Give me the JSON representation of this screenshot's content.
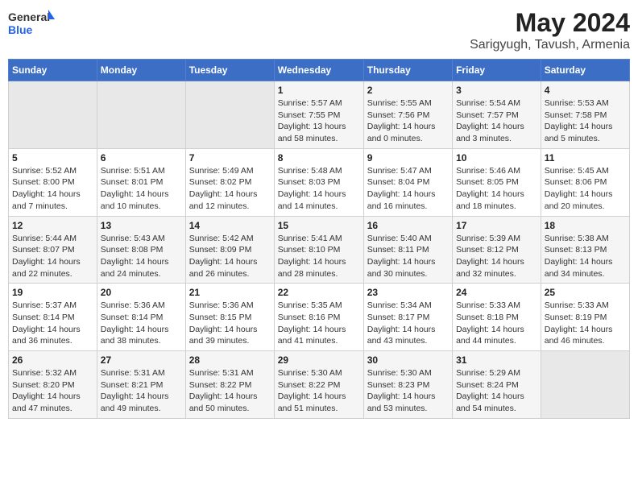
{
  "header": {
    "logo_text_general": "General",
    "logo_text_blue": "Blue",
    "month_year": "May 2024",
    "location": "Sarigyugh, Tavush, Armenia"
  },
  "calendar": {
    "days_of_week": [
      "Sunday",
      "Monday",
      "Tuesday",
      "Wednesday",
      "Thursday",
      "Friday",
      "Saturday"
    ],
    "weeks": [
      [
        {
          "day": "",
          "info": ""
        },
        {
          "day": "",
          "info": ""
        },
        {
          "day": "",
          "info": ""
        },
        {
          "day": "1",
          "info": "Sunrise: 5:57 AM\nSunset: 7:55 PM\nDaylight: 13 hours and 58 minutes."
        },
        {
          "day": "2",
          "info": "Sunrise: 5:55 AM\nSunset: 7:56 PM\nDaylight: 14 hours and 0 minutes."
        },
        {
          "day": "3",
          "info": "Sunrise: 5:54 AM\nSunset: 7:57 PM\nDaylight: 14 hours and 3 minutes."
        },
        {
          "day": "4",
          "info": "Sunrise: 5:53 AM\nSunset: 7:58 PM\nDaylight: 14 hours and 5 minutes."
        }
      ],
      [
        {
          "day": "5",
          "info": "Sunrise: 5:52 AM\nSunset: 8:00 PM\nDaylight: 14 hours and 7 minutes."
        },
        {
          "day": "6",
          "info": "Sunrise: 5:51 AM\nSunset: 8:01 PM\nDaylight: 14 hours and 10 minutes."
        },
        {
          "day": "7",
          "info": "Sunrise: 5:49 AM\nSunset: 8:02 PM\nDaylight: 14 hours and 12 minutes."
        },
        {
          "day": "8",
          "info": "Sunrise: 5:48 AM\nSunset: 8:03 PM\nDaylight: 14 hours and 14 minutes."
        },
        {
          "day": "9",
          "info": "Sunrise: 5:47 AM\nSunset: 8:04 PM\nDaylight: 14 hours and 16 minutes."
        },
        {
          "day": "10",
          "info": "Sunrise: 5:46 AM\nSunset: 8:05 PM\nDaylight: 14 hours and 18 minutes."
        },
        {
          "day": "11",
          "info": "Sunrise: 5:45 AM\nSunset: 8:06 PM\nDaylight: 14 hours and 20 minutes."
        }
      ],
      [
        {
          "day": "12",
          "info": "Sunrise: 5:44 AM\nSunset: 8:07 PM\nDaylight: 14 hours and 22 minutes."
        },
        {
          "day": "13",
          "info": "Sunrise: 5:43 AM\nSunset: 8:08 PM\nDaylight: 14 hours and 24 minutes."
        },
        {
          "day": "14",
          "info": "Sunrise: 5:42 AM\nSunset: 8:09 PM\nDaylight: 14 hours and 26 minutes."
        },
        {
          "day": "15",
          "info": "Sunrise: 5:41 AM\nSunset: 8:10 PM\nDaylight: 14 hours and 28 minutes."
        },
        {
          "day": "16",
          "info": "Sunrise: 5:40 AM\nSunset: 8:11 PM\nDaylight: 14 hours and 30 minutes."
        },
        {
          "day": "17",
          "info": "Sunrise: 5:39 AM\nSunset: 8:12 PM\nDaylight: 14 hours and 32 minutes."
        },
        {
          "day": "18",
          "info": "Sunrise: 5:38 AM\nSunset: 8:13 PM\nDaylight: 14 hours and 34 minutes."
        }
      ],
      [
        {
          "day": "19",
          "info": "Sunrise: 5:37 AM\nSunset: 8:14 PM\nDaylight: 14 hours and 36 minutes."
        },
        {
          "day": "20",
          "info": "Sunrise: 5:36 AM\nSunset: 8:14 PM\nDaylight: 14 hours and 38 minutes."
        },
        {
          "day": "21",
          "info": "Sunrise: 5:36 AM\nSunset: 8:15 PM\nDaylight: 14 hours and 39 minutes."
        },
        {
          "day": "22",
          "info": "Sunrise: 5:35 AM\nSunset: 8:16 PM\nDaylight: 14 hours and 41 minutes."
        },
        {
          "day": "23",
          "info": "Sunrise: 5:34 AM\nSunset: 8:17 PM\nDaylight: 14 hours and 43 minutes."
        },
        {
          "day": "24",
          "info": "Sunrise: 5:33 AM\nSunset: 8:18 PM\nDaylight: 14 hours and 44 minutes."
        },
        {
          "day": "25",
          "info": "Sunrise: 5:33 AM\nSunset: 8:19 PM\nDaylight: 14 hours and 46 minutes."
        }
      ],
      [
        {
          "day": "26",
          "info": "Sunrise: 5:32 AM\nSunset: 8:20 PM\nDaylight: 14 hours and 47 minutes."
        },
        {
          "day": "27",
          "info": "Sunrise: 5:31 AM\nSunset: 8:21 PM\nDaylight: 14 hours and 49 minutes."
        },
        {
          "day": "28",
          "info": "Sunrise: 5:31 AM\nSunset: 8:22 PM\nDaylight: 14 hours and 50 minutes."
        },
        {
          "day": "29",
          "info": "Sunrise: 5:30 AM\nSunset: 8:22 PM\nDaylight: 14 hours and 51 minutes."
        },
        {
          "day": "30",
          "info": "Sunrise: 5:30 AM\nSunset: 8:23 PM\nDaylight: 14 hours and 53 minutes."
        },
        {
          "day": "31",
          "info": "Sunrise: 5:29 AM\nSunset: 8:24 PM\nDaylight: 14 hours and 54 minutes."
        },
        {
          "day": "",
          "info": ""
        }
      ]
    ]
  }
}
